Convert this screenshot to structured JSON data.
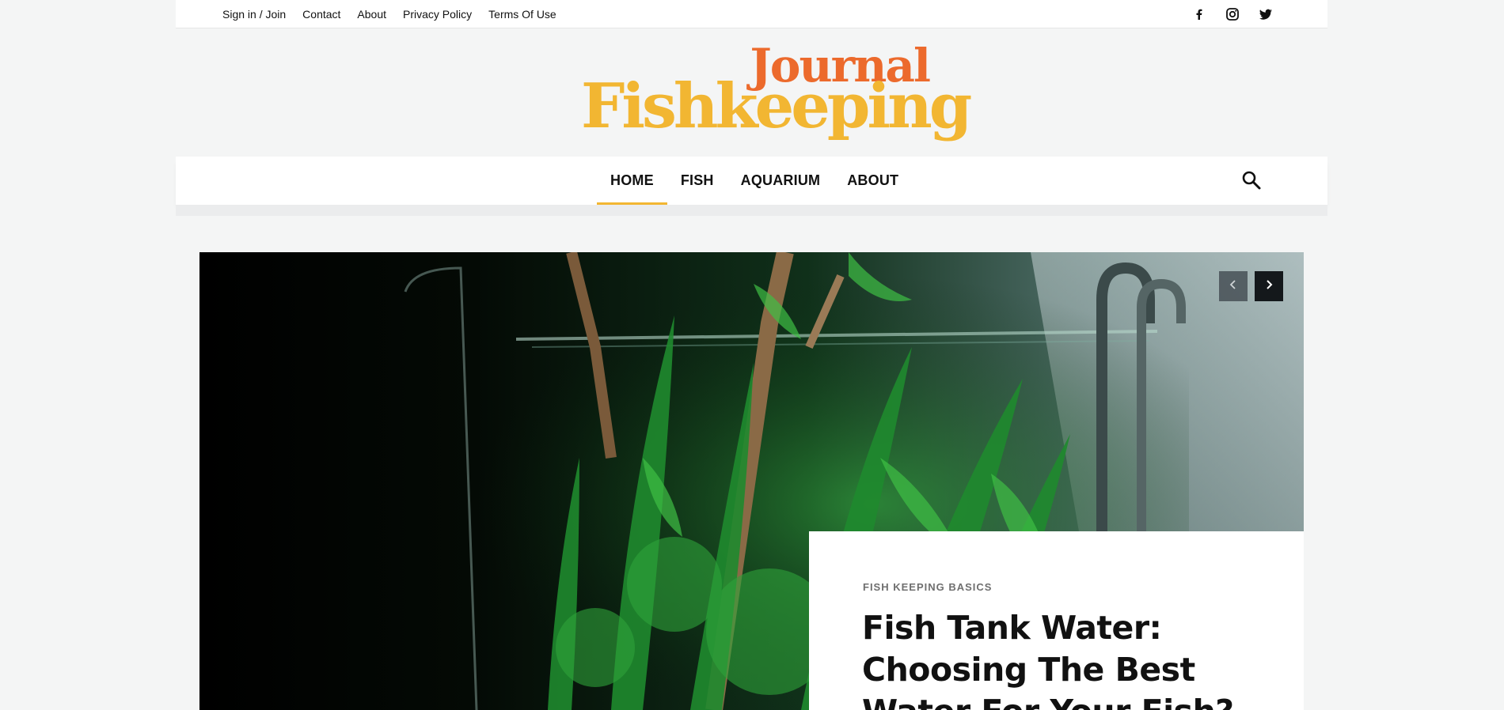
{
  "topbar": {
    "links": [
      "Sign in / Join",
      "Contact",
      "About",
      "Privacy Policy",
      "Terms Of Use"
    ],
    "social_icons": [
      "facebook-icon",
      "instagram-icon",
      "twitter-icon"
    ]
  },
  "logo": {
    "line1": "Journal",
    "line2": "Fishkeeping"
  },
  "nav": {
    "items": [
      "HOME",
      "FISH",
      "AQUARIUM",
      "ABOUT"
    ],
    "active": "HOME",
    "search_icon": "search-icon"
  },
  "hero": {
    "category": "FISH KEEPING BASICS",
    "title": "Fish Tank Water: Choosing The Best Water For Your Fish?",
    "prev_icon": "chevron-left-icon",
    "next_icon": "chevron-right-icon"
  },
  "colors": {
    "accent_yellow": "#f2b632",
    "accent_orange": "#ec6a2c",
    "page_bg": "#f4f5f5"
  }
}
